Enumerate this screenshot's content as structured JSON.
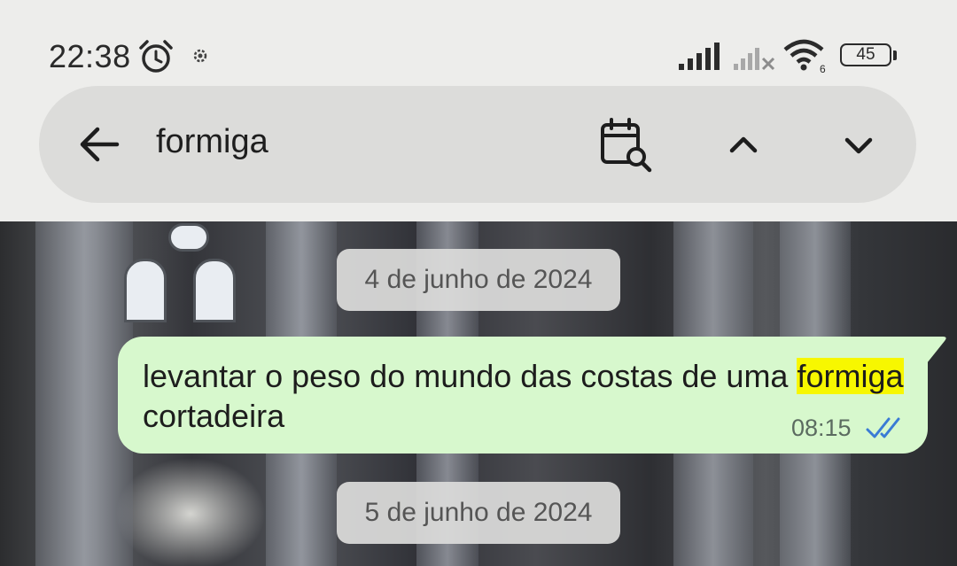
{
  "status_bar": {
    "time": "22:38",
    "battery_level": "45",
    "wifi_badge": "6",
    "icons": [
      "alarm-clock-icon",
      "gear-icon",
      "signal-icon",
      "signal-no-service-icon",
      "wifi-icon",
      "battery-icon"
    ]
  },
  "search": {
    "back_icon": "arrow-left-icon",
    "query": "formiga",
    "calendar_icon": "calendar-search-icon",
    "prev_icon": "chevron-up-icon",
    "next_icon": "chevron-down-icon"
  },
  "chat": {
    "date_1": "4 de junho de 2024",
    "date_2": "5 de junho de 2024",
    "message": {
      "text_before": "levantar o peso do mundo das costas de uma ",
      "highlight": "formiga",
      "text_after": " cortadeira",
      "time": "08:15",
      "status_icon": "double-check-icon",
      "bubble_color": "#d7f8cd",
      "highlight_color": "#f7f700",
      "tick_color": "#3a7bd5"
    }
  }
}
